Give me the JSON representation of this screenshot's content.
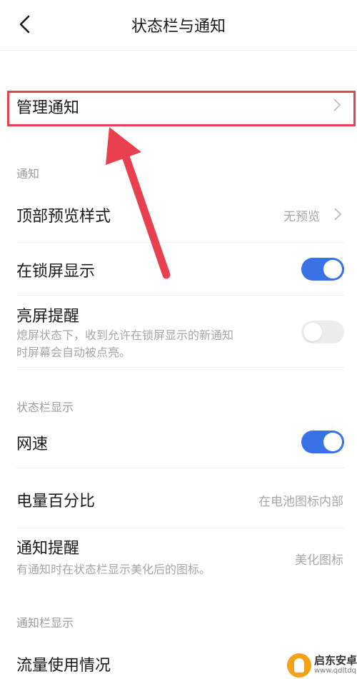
{
  "header": {
    "title": "状态栏与通知"
  },
  "manage_row": {
    "label": "管理通知"
  },
  "notify_section": {
    "heading": "通知",
    "preview_style": {
      "label": "顶部预览样式",
      "value": "无预览"
    },
    "lockscreen": {
      "label": "在锁屏显示",
      "toggle": "on"
    },
    "wake_screen": {
      "label": "亮屏提醒",
      "desc_line1": "熄屏状态下，收到允许在锁屏显示的新通知",
      "desc_line2": "时屏幕会自动被点亮。",
      "toggle": "off"
    }
  },
  "statusbar_section": {
    "heading": "状态栏显示",
    "net_speed": {
      "label": "网速",
      "toggle": "on"
    },
    "battery": {
      "label": "电量百分比",
      "value": "在电池图标内部"
    },
    "notify_hint": {
      "label": "通知提醒",
      "desc": "有通知时在状态栏显示美化后的图标。",
      "value": "美化图标"
    }
  },
  "notifybar_section": {
    "heading": "通知栏显示",
    "data_usage": {
      "label": "流量使用情况"
    }
  },
  "watermark": {
    "name": "启东安卓网",
    "url": "www.qdltdq.com"
  },
  "colors": {
    "accent": "#3872e6",
    "annotation": "#e8404f",
    "secondary_text": "#a6a6a6"
  }
}
